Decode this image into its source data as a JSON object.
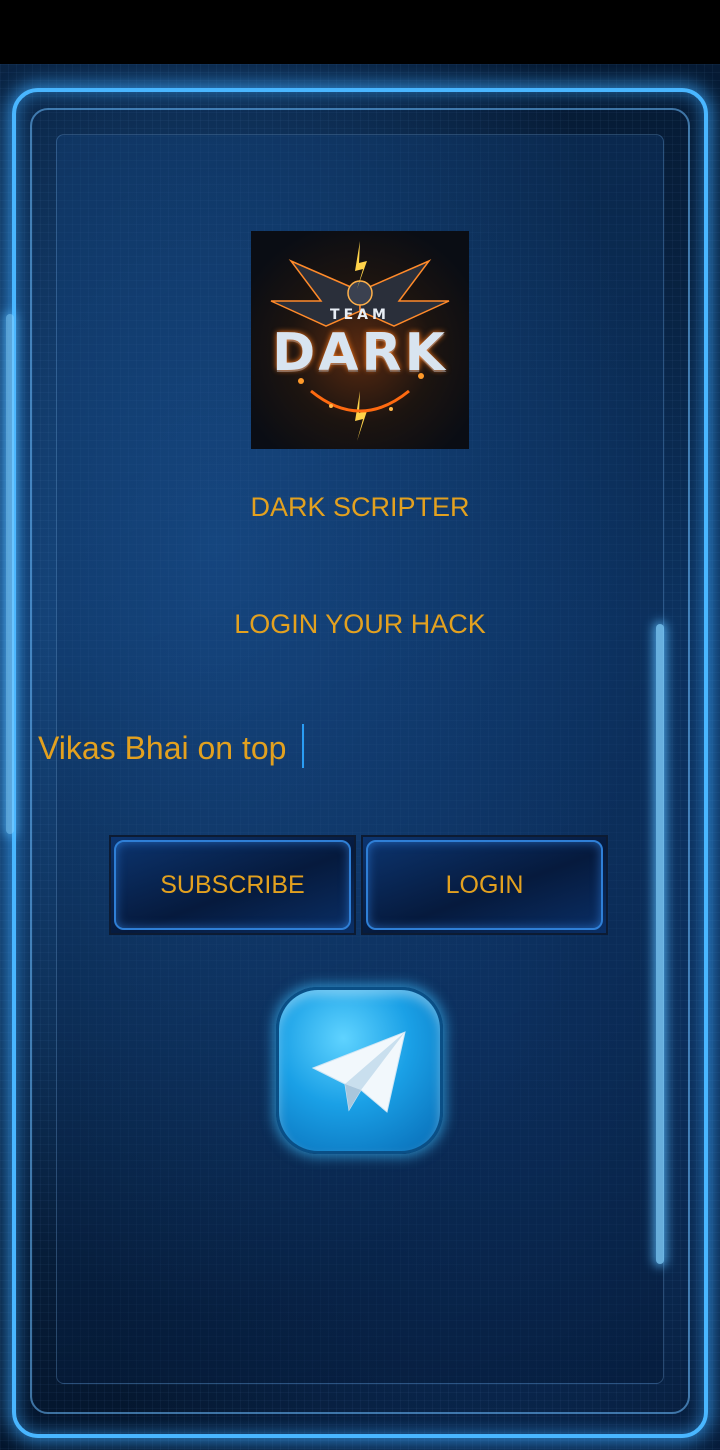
{
  "app": {
    "title": "DARK SCRIPTER",
    "subtitle": "LOGIN YOUR HACK"
  },
  "logo": {
    "team_text": "TEAM",
    "main_text": "DARK",
    "icon": "team-dark-eagle-logo"
  },
  "key_input": {
    "value": "Vikas Bhai on top",
    "placeholder": ""
  },
  "buttons": {
    "subscribe_label": "SUBSCRIBE",
    "login_label": "LOGIN"
  },
  "telegram": {
    "icon": "telegram-paper-plane-icon"
  },
  "colors": {
    "accent_text": "#e3a11f",
    "frame_glow": "#49b6ff",
    "background": "#0a2d55"
  }
}
